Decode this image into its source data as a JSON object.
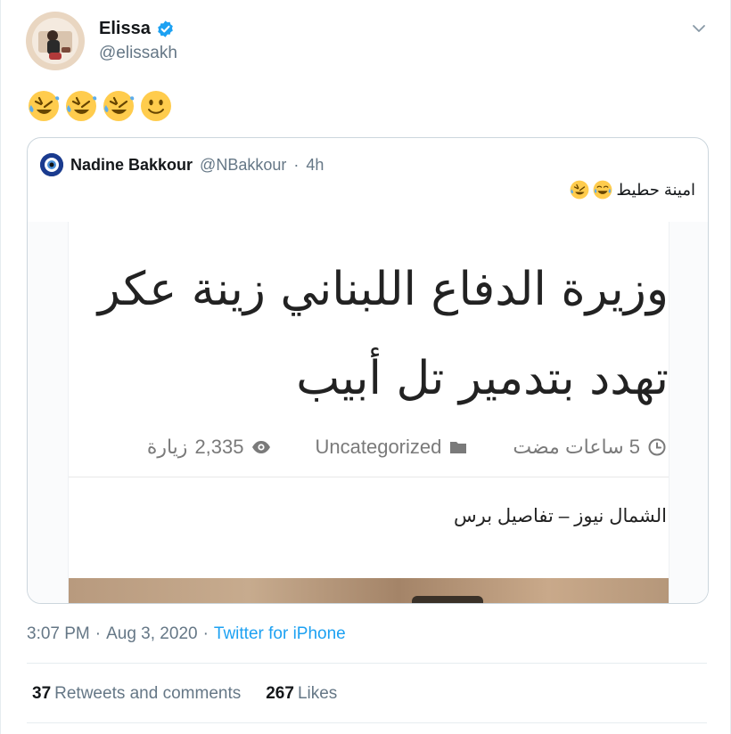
{
  "author": {
    "name": "Elissa",
    "handle": "@elissakh",
    "verified": true
  },
  "tweet": {
    "emojis": [
      "rofl-emoji",
      "rofl-emoji",
      "rofl-emoji",
      "slightly-smiling-emoji"
    ]
  },
  "quote": {
    "name": "Nadine Bakkour",
    "handle": "@NBakkour",
    "separator": "·",
    "age": "4h",
    "text": "امينة حطيط",
    "text_emojis": [
      "rofl-emoji",
      "joy-emoji"
    ],
    "article": {
      "headline": "وزيرة الدفاع اللبناني زينة عكر تهدد بتدمير تل أبيب",
      "time": "5 ساعات مضت",
      "category": "Uncategorized",
      "views_count": "2,335",
      "views_label": "زيارة",
      "source": "الشمال نيوز – تفاصيل برس"
    }
  },
  "footer": {
    "time": "3:07 PM",
    "dot1": "·",
    "date": "Aug 3, 2020",
    "dot2": "·",
    "client": "Twitter for iPhone",
    "retweets_count": "37",
    "retweets_label": "Retweets and comments",
    "likes_count": "267",
    "likes_label": "Likes"
  },
  "colors": {
    "accent": "#1da1f2",
    "secondary_text": "#657786",
    "border": "#e6ecf0"
  }
}
